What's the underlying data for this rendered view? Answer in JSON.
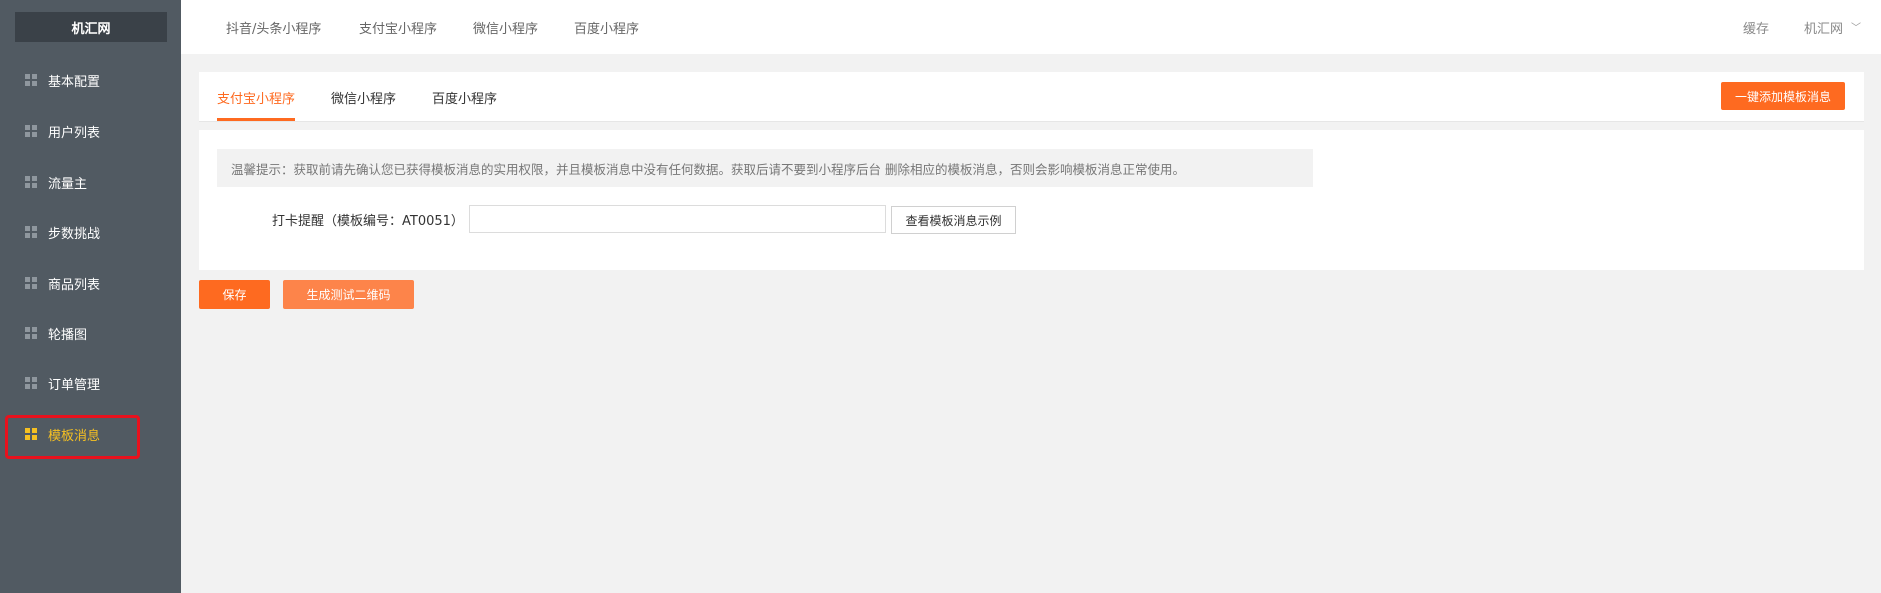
{
  "sidebar": {
    "logo": "机汇网",
    "items": [
      {
        "label": "基本配置"
      },
      {
        "label": "用户列表"
      },
      {
        "label": "流量主"
      },
      {
        "label": "步数挑战"
      },
      {
        "label": "商品列表"
      },
      {
        "label": "轮播图"
      },
      {
        "label": "订单管理"
      },
      {
        "label": "模板消息"
      }
    ],
    "active_index": 7,
    "active_color": "#f5c022"
  },
  "header": {
    "nav": [
      "抖音/头条小程序",
      "支付宝小程序",
      "微信小程序",
      "百度小程序"
    ],
    "cache_label": "缓存",
    "user_label": "机汇网",
    "user_menu_icon": "chevron-down-icon"
  },
  "tabs": {
    "items": [
      "支付宝小程序",
      "微信小程序",
      "百度小程序"
    ],
    "active_index": 0,
    "add_button": "一键添加模板消息"
  },
  "form": {
    "tip": "温馨提示：获取前请先确认您已获得模板消息的实用权限，并且模板消息中没有任何数据。获取后请不要到小程序后台 删除相应的模板消息，否则会影响模板消息正常使用。",
    "field_label": "打卡提醒（模板编号：AT0051）",
    "field_value": "",
    "example_button": "查看模板消息示例"
  },
  "actions": {
    "save": "保存",
    "qrcode": "生成测试二维码"
  },
  "colors": {
    "accent": "#fe6a20",
    "sidebar_bg": "#515a62",
    "highlight": "#e8111d"
  }
}
